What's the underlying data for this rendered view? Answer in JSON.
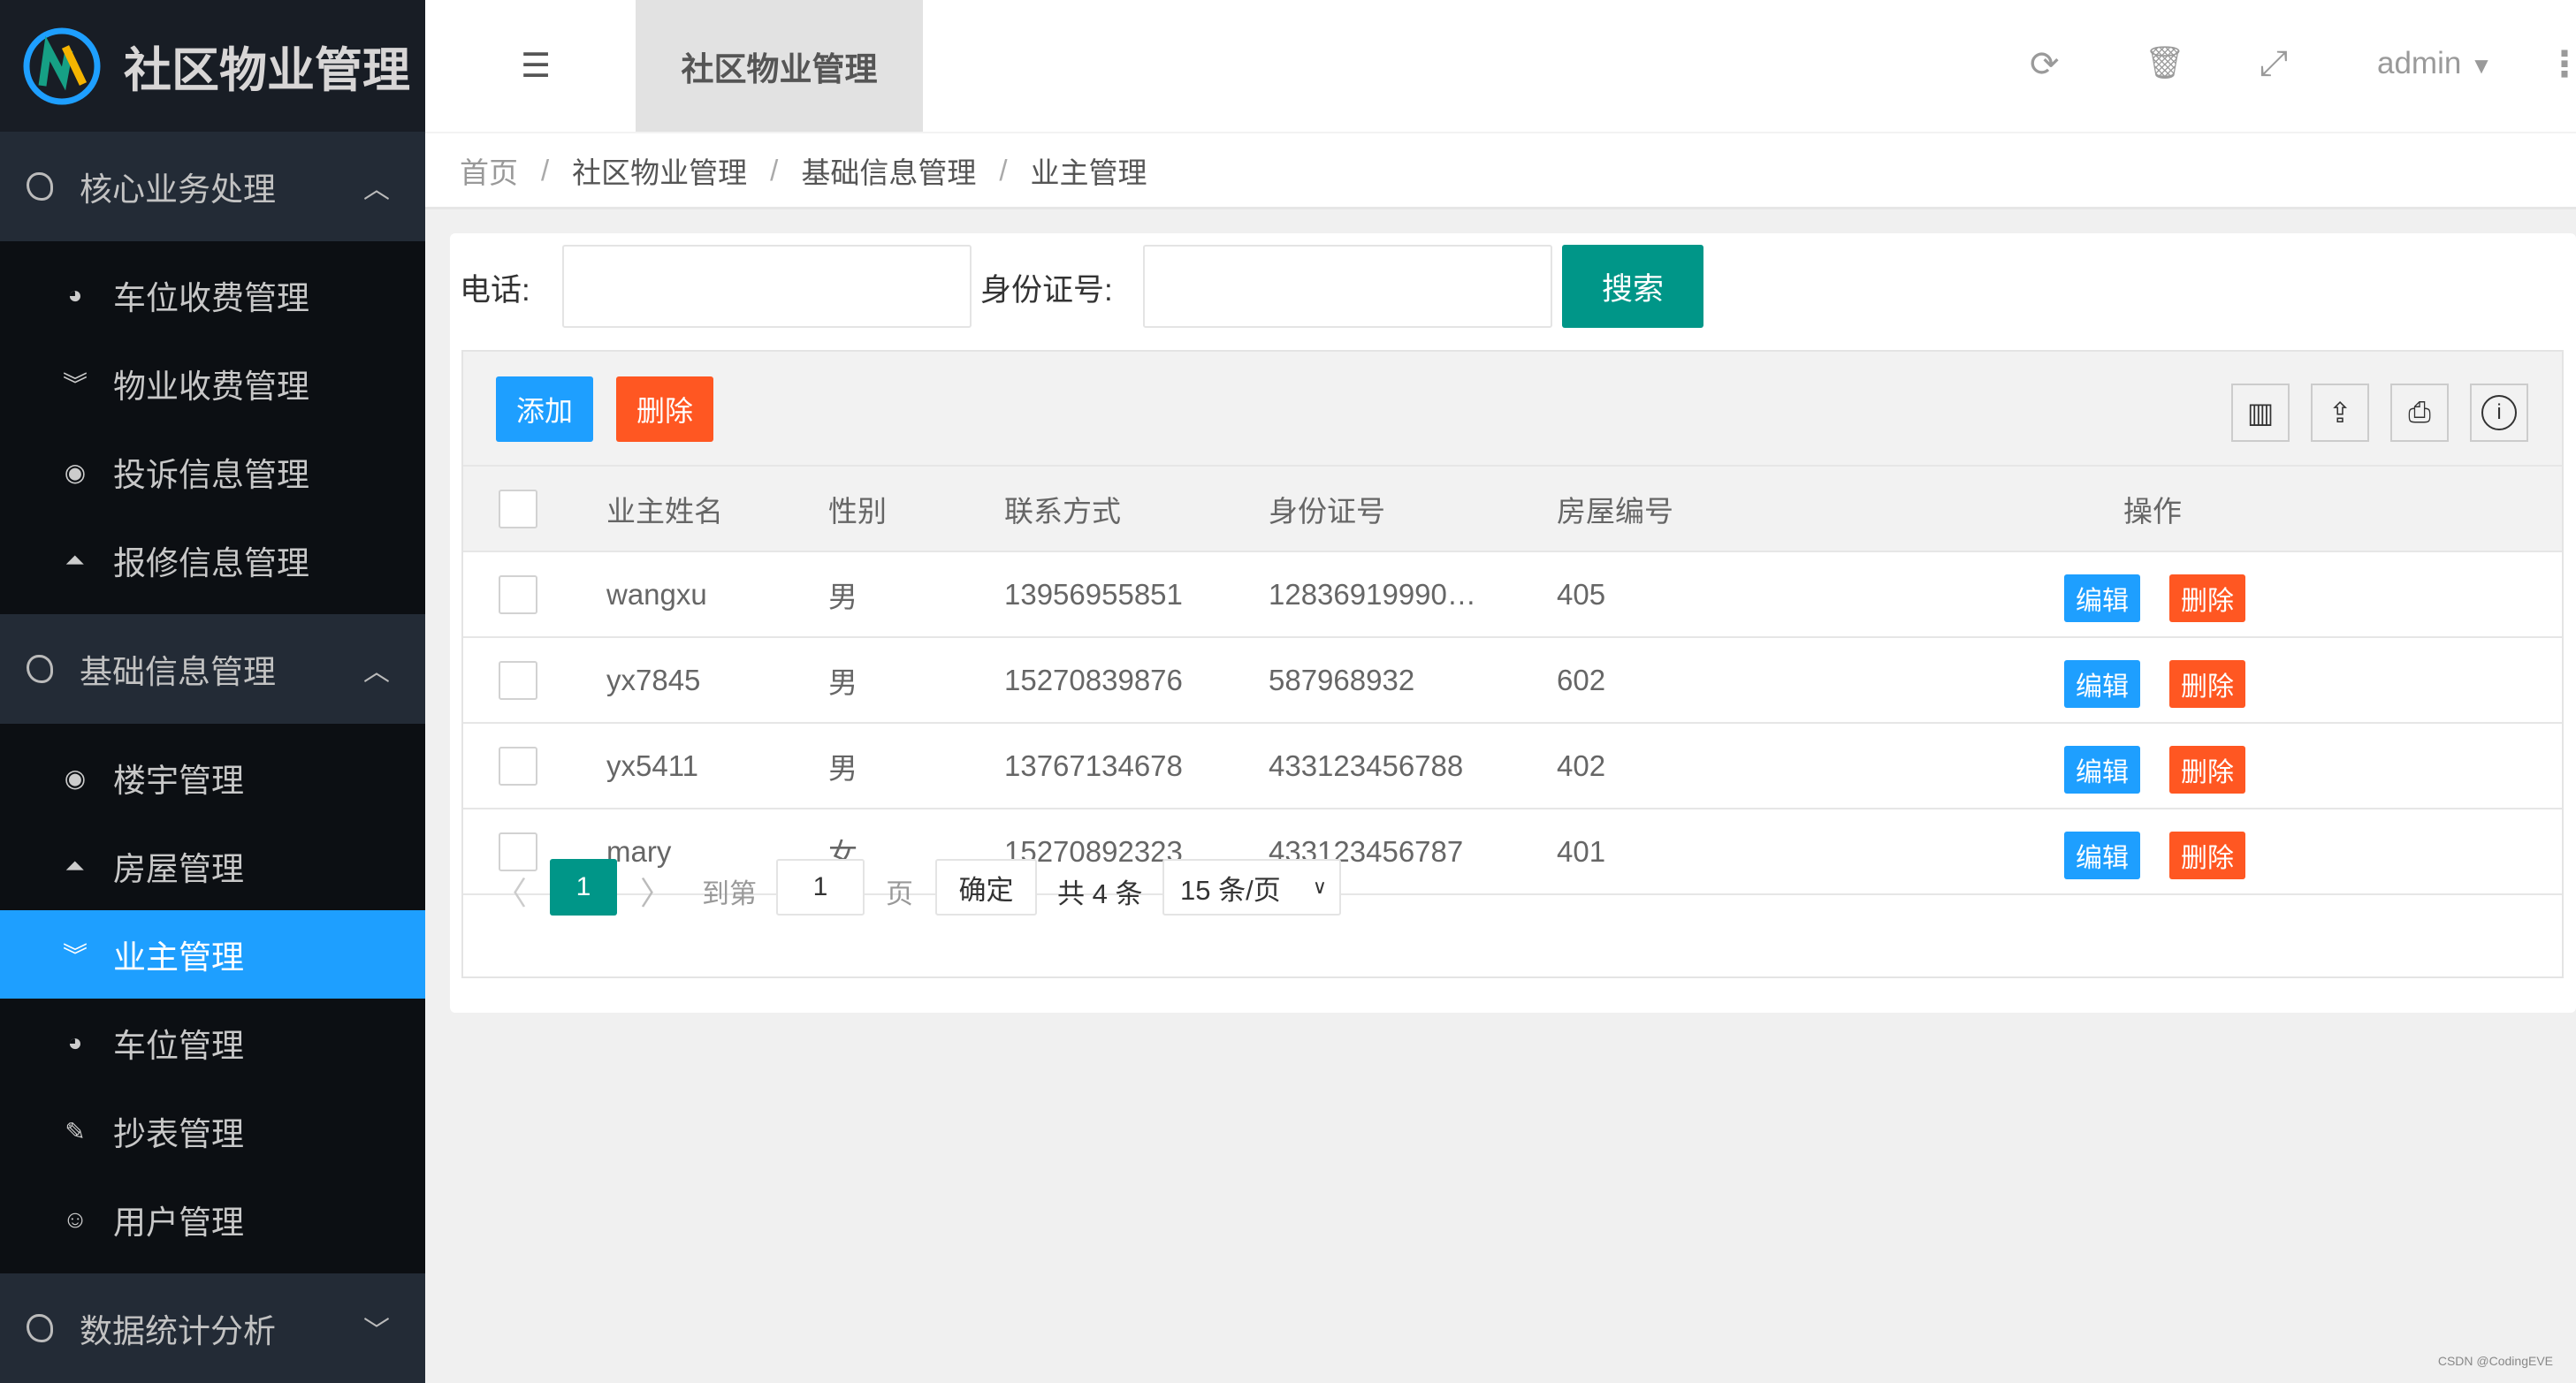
{
  "app": {
    "title": "社区物业管理"
  },
  "sidebar": {
    "groups": [
      {
        "label": "核心业务处理",
        "items": [
          {
            "label": "车位收费管理",
            "icon": "dashboard-icon"
          },
          {
            "label": "物业收费管理",
            "icon": "double-chevron-down-icon"
          },
          {
            "label": "投诉信息管理",
            "icon": "target-icon"
          },
          {
            "label": "报修信息管理",
            "icon": "up-circle-icon"
          }
        ]
      },
      {
        "label": "基础信息管理",
        "items": [
          {
            "label": "楼宇管理",
            "icon": "target-icon"
          },
          {
            "label": "房屋管理",
            "icon": "up-circle-icon"
          },
          {
            "label": "业主管理",
            "icon": "double-chevron-down-icon",
            "active": true
          },
          {
            "label": "车位管理",
            "icon": "dashboard-icon"
          },
          {
            "label": "抄表管理",
            "icon": "edit-icon"
          },
          {
            "label": "用户管理",
            "icon": "user-circle-icon"
          }
        ]
      },
      {
        "label": "数据统计分析",
        "items": []
      }
    ]
  },
  "header": {
    "tab": "社区物业管理",
    "user": "admin"
  },
  "breadcrumb": [
    "首页",
    "社区物业管理",
    "基础信息管理",
    "业主管理"
  ],
  "search": {
    "phone_label": "电话:",
    "phone_value": "",
    "id_label": "身份证号:",
    "id_value": "",
    "button": "搜索"
  },
  "toolbar": {
    "add": "添加",
    "delete": "删除"
  },
  "table": {
    "columns": [
      "业主姓名",
      "性别",
      "联系方式",
      "身份证号",
      "房屋编号",
      "操作"
    ],
    "rows": [
      {
        "name": "wangxu",
        "gender": "男",
        "phone": "13956955851",
        "id": "12836919990…",
        "house": "405"
      },
      {
        "name": "yx7845",
        "gender": "男",
        "phone": "15270839876",
        "id": "587968932",
        "house": "602"
      },
      {
        "name": "yx5411",
        "gender": "男",
        "phone": "13767134678",
        "id": "433123456788",
        "house": "402"
      },
      {
        "name": "mary",
        "gender": "女",
        "phone": "15270892323",
        "id": "433123456787",
        "house": "401"
      }
    ],
    "edit": "编辑",
    "delete": "删除"
  },
  "pagination": {
    "current": "1",
    "goto_label": "到第",
    "goto_value": "1",
    "page_label": "页",
    "confirm": "确定",
    "total": "共 4 条",
    "page_size": "15 条/页"
  },
  "watermark": "CSDN @CodingEVE",
  "colors": {
    "primary": "#009688",
    "blue": "#1e9fff",
    "danger": "#ff5722",
    "sidebar": "#0c0f13"
  }
}
